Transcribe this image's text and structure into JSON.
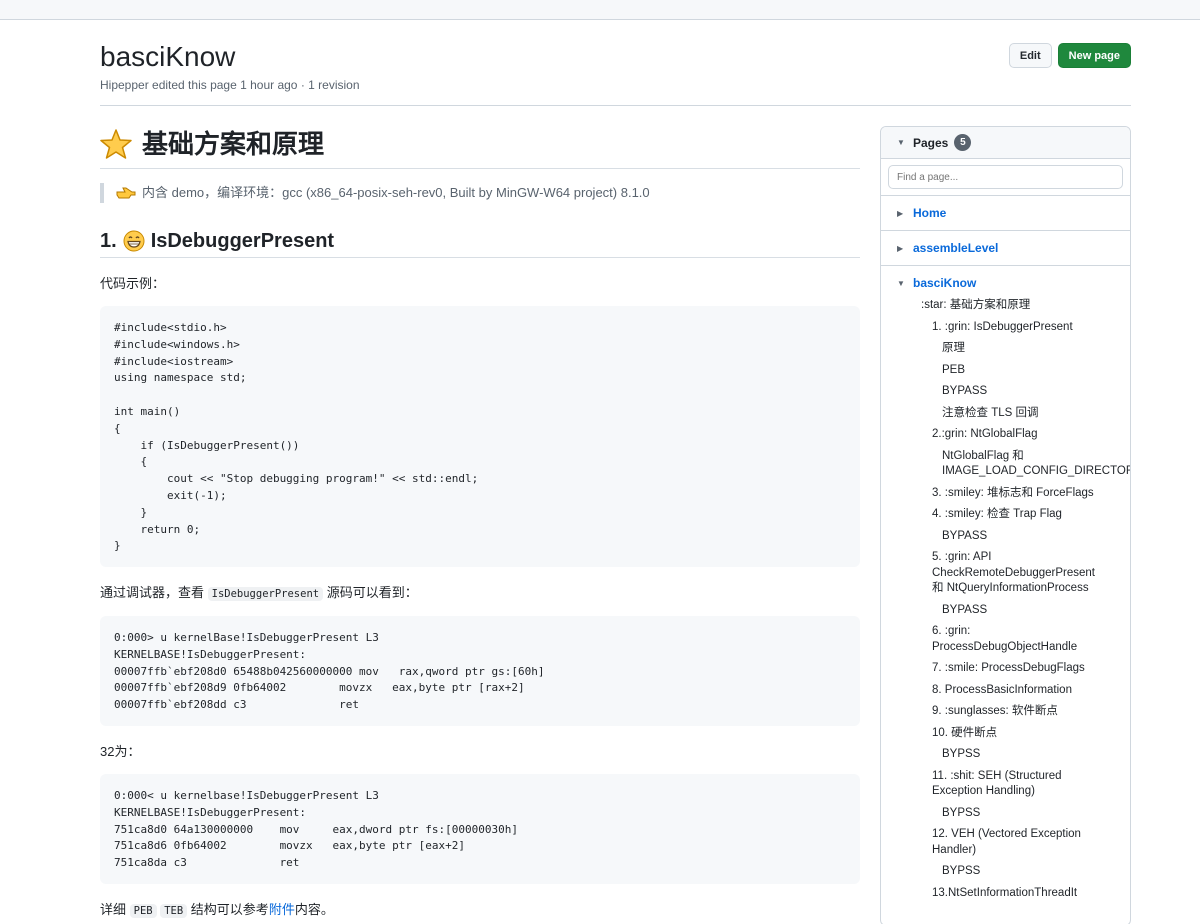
{
  "header": {
    "title": "basciKnow",
    "meta": "Hipepper edited this page 1 hour ago · 1 revision",
    "edit_label": "Edit",
    "new_page_label": "New page"
  },
  "content": {
    "h1": "基础方案和原理",
    "quote": "内含 demo，编译环境：gcc (x86_64-posix-seh-rev0, Built by MinGW-W64 project) 8.1.0",
    "h2_number": "1.",
    "h2_text": "IsDebuggerPresent",
    "p_code_example": "代码示例：",
    "code1": "#include<stdio.h>\n#include<windows.h>\n#include<iostream>\nusing namespace std;\n\nint main()\n{\n    if (IsDebuggerPresent())\n    {\n        cout << \"Stop debugging program!\" << std::endl;\n        exit(-1);\n    }\n    return 0;\n}",
    "p_debugger_before": "通过调试器，查看 ",
    "p_debugger_code": "IsDebuggerPresent",
    "p_debugger_after": " 源码可以看到：",
    "code2": "0:000> u kernelBase!IsDebuggerPresent L3\nKERNELBASE!IsDebuggerPresent:\n00007ffb`ebf208d0 65488b042560000000 mov   rax,qword ptr gs:[60h]\n00007ffb`ebf208d9 0fb64002        movzx   eax,byte ptr [rax+2]\n00007ffb`ebf208dd c3              ret",
    "p_32": "32为：",
    "code3": "0:000< u kernelbase!IsDebuggerPresent L3\nKERNELBASE!IsDebuggerPresent:\n751ca8d0 64a130000000    mov     eax,dword ptr fs:[00000030h]\n751ca8d6 0fb64002        movzx   eax,byte ptr [eax+2]\n751ca8da c3              ret",
    "p_detail_before": "详细 ",
    "p_detail_code1": "PEB",
    "p_detail_code2": "TEB",
    "p_detail_mid": " 结构可以参考",
    "p_detail_link": "附件",
    "p_detail_after": "内容。"
  },
  "sidebar": {
    "pages_label": "Pages",
    "pages_count": "5",
    "search_placeholder": "Find a page...",
    "pages": [
      {
        "label": "Home"
      },
      {
        "label": "assembleLevel"
      }
    ],
    "current": "basciKnow",
    "toc": [
      {
        "text": ":star: 基础方案和原理",
        "level": 1
      },
      {
        "text": "1. :grin: IsDebuggerPresent",
        "level": 2
      },
      {
        "text": "原理",
        "level": 3
      },
      {
        "text": "PEB",
        "level": 3
      },
      {
        "text": "BYPASS",
        "level": 3
      },
      {
        "text": "注意检查 TLS 回调",
        "level": 3
      },
      {
        "text": "2.:grin: NtGlobalFlag",
        "level": 2
      },
      {
        "text": "NtGlobalFlag 和 IMAGE_LOAD_CONFIG_DIRECTORY",
        "level": 3
      },
      {
        "text": "3. :smiley: 堆标志和 ForceFlags",
        "level": 2
      },
      {
        "text": "4. :smiley: 检查 Trap Flag",
        "level": 2
      },
      {
        "text": "BYPASS",
        "level": 3
      },
      {
        "text": "5. :grin: API CheckRemoteDebuggerPresent 和 NtQueryInformationProcess",
        "level": 2
      },
      {
        "text": "BYPASS",
        "level": 3
      },
      {
        "text": "6. :grin: ProcessDebugObjectHandle",
        "level": 2
      },
      {
        "text": "7. :smile: ProcessDebugFlags",
        "level": 2
      },
      {
        "text": "8. ProcessBasicInformation",
        "level": 2
      },
      {
        "text": "9. :sunglasses: 软件断点",
        "level": 2
      },
      {
        "text": "10. 硬件断点",
        "level": 2
      },
      {
        "text": "BYPSS",
        "level": 3
      },
      {
        "text": "11. :shit: SEH (Structured Exception Handling)",
        "level": 2
      },
      {
        "text": "BYPSS",
        "level": 3
      },
      {
        "text": "12. VEH (Vectored Exception Handler)",
        "level": 2
      },
      {
        "text": "BYPSS",
        "level": 3
      },
      {
        "text": "13.NtSetInformationThreadIt",
        "level": 2
      }
    ]
  }
}
